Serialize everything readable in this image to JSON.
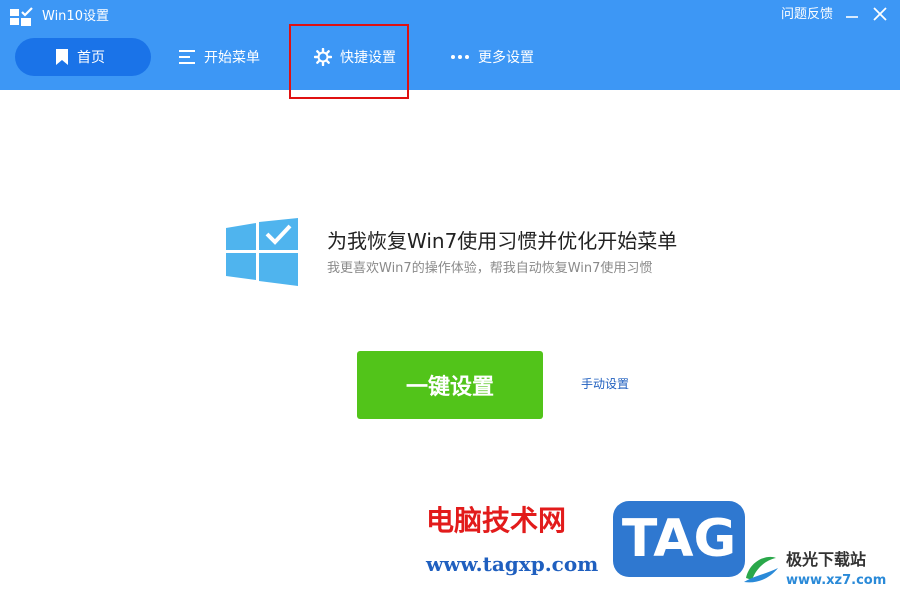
{
  "window": {
    "title": "Win10设置",
    "feedback_label": "问题反馈",
    "minimize_icon": "minimize-icon",
    "close_icon": "close-icon"
  },
  "nav": {
    "tabs": [
      {
        "label": "首页",
        "icon": "bookmark-icon",
        "active": true
      },
      {
        "label": "开始菜单",
        "icon": "menu-lines-icon"
      },
      {
        "label": "快捷设置",
        "icon": "gear-icon",
        "highlighted": true
      },
      {
        "label": "更多设置",
        "icon": "more-dots-icon"
      }
    ]
  },
  "main": {
    "logo_icon": "windows-logo-check-icon",
    "headline": "为我恢复Win7使用习惯并优化开始菜单",
    "subline": "我更喜欢Win7的操作体验，帮我自动恢复Win7使用习惯",
    "primary_button": "一键设置",
    "manual_link": "手动设置"
  },
  "watermark": {
    "site_name": "电脑技术网",
    "site_url": "www.tagxp.com",
    "tag_label": "TAG",
    "partner_name": "极光下载站",
    "partner_url": "www.xz7.com"
  },
  "colors": {
    "header_blue": "#3d97f5",
    "active_tab": "#1a73e8",
    "button_green": "#52c41a",
    "highlight_red": "#e01111",
    "link_blue": "#1f5fbf"
  }
}
